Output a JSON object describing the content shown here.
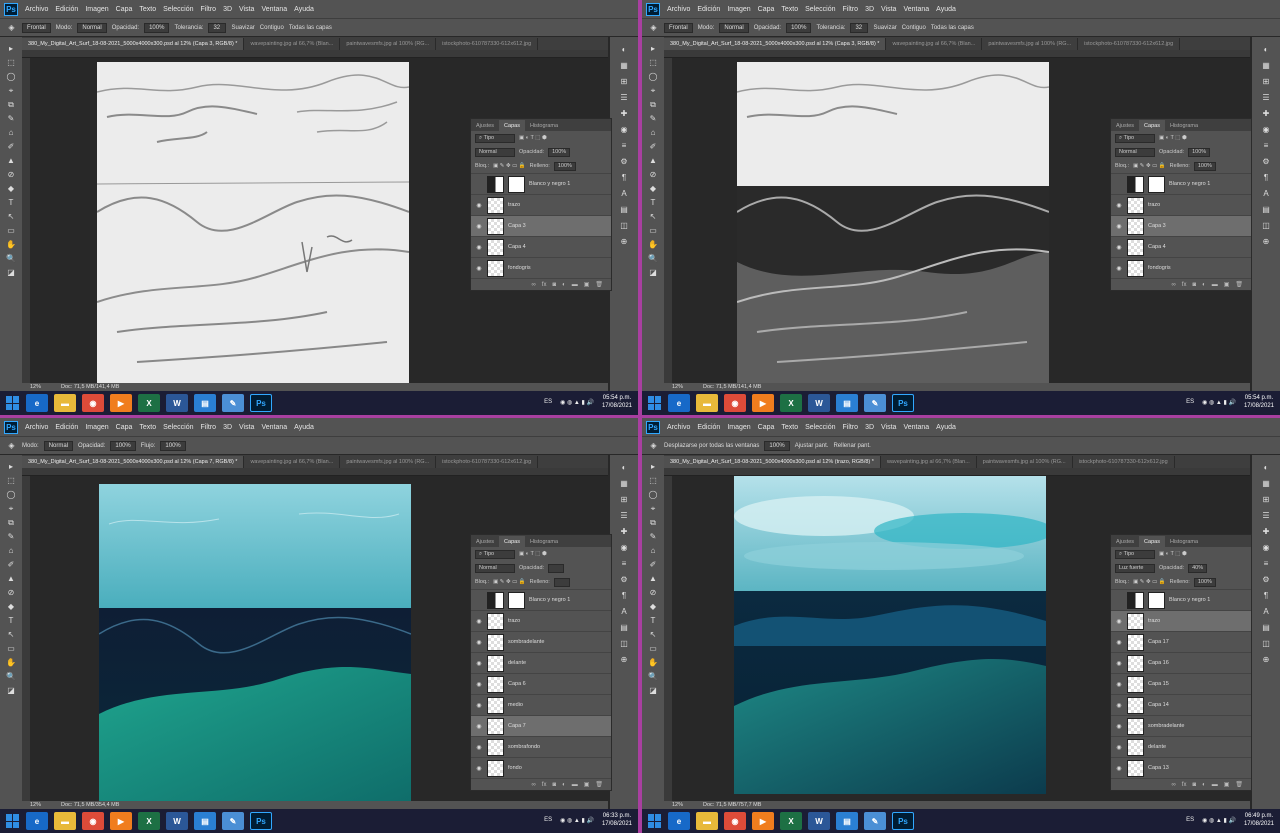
{
  "menu": [
    "Archivo",
    "Edición",
    "Imagen",
    "Capa",
    "Texto",
    "Selección",
    "Filtro",
    "3D",
    "Vista",
    "Ventana",
    "Ayuda"
  ],
  "app_logo": "Ps",
  "quadrants": [
    {
      "id": "tl",
      "options": [
        "Frontal",
        "Modo:",
        "Normal",
        "Opacidad:",
        "100%",
        "Tolerancia:",
        "32",
        "Suavizar",
        "Contiguo",
        "Todas las capas"
      ],
      "tabs": [
        "380_My_Digital_Art_Surf_18-08-2021_5000x4000x300.psd al 12% (Capa 3, RGB/8) *",
        "wavepainting.jpg al 66,7% (Blan...",
        "paintwavesmfs.jpg al 100% (RG...",
        "istockphoto-610787330-612x612.jpg"
      ],
      "zoom": "12%",
      "doc": "Doc: 71,5 MB/141,4 MB",
      "panel_tabs": [
        "Ajustes",
        "Capas",
        "Histograma"
      ],
      "filter": "Tipo",
      "blend": "Normal",
      "opacity_label": "Opacidad:",
      "opacity": "100%",
      "fill_label": "Relleno:",
      "fill": "100%",
      "lock": "Bloq.:",
      "layers": [
        "Blanco y negro 1",
        "trazo",
        "Capa 3",
        "Capa 4",
        "fondogris"
      ],
      "selected": 2,
      "time": "05:54 p.m.",
      "date": "17/08/2021"
    },
    {
      "id": "tr",
      "options": [
        "Frontal",
        "Modo:",
        "Normal",
        "Opacidad:",
        "100%",
        "Tolerancia:",
        "32",
        "Suavizar",
        "Contiguo",
        "Todas las capas"
      ],
      "tabs": [
        "380_My_Digital_Art_Surf_18-08-2021_5000x4000x300.psd al 12% (Capa 3, RGB/8) *",
        "wavepainting.jpg al 66,7% (Blan...",
        "paintwavesmfs.jpg al 100% (RG...",
        "istockphoto-610787330-612x612.jpg"
      ],
      "zoom": "12%",
      "doc": "Doc: 71,5 MB/141,4 MB",
      "panel_tabs": [
        "Ajustes",
        "Capas",
        "Histograma"
      ],
      "filter": "Tipo",
      "blend": "Normal",
      "opacity_label": "Opacidad:",
      "opacity": "100%",
      "fill_label": "Relleno:",
      "fill": "100%",
      "lock": "Bloq.:",
      "layers": [
        "Blanco y negro 1",
        "trazo",
        "Capa 3",
        "Capa 4",
        "fondogris"
      ],
      "selected": 2,
      "time": "05:54 p.m.",
      "date": "17/08/2021"
    },
    {
      "id": "bl",
      "options": [
        "Modo:",
        "Normal",
        "Opacidad:",
        "100%",
        "Flujo:",
        "100%"
      ],
      "tabs": [
        "380_My_Digital_Art_Surf_18-08-2021_5000x4000x300.psd al 12% (Capa 7, RGB/8) *",
        "wavepainting.jpg al 66,7% (Blan...",
        "paintwavesmfs.jpg al 100% (RG...",
        "istockphoto-610787330-612x612.jpg"
      ],
      "zoom": "12%",
      "doc": "Doc: 71,5 MB/354,4 MB",
      "panel_tabs": [
        "Ajustes",
        "Capas",
        "Histograma"
      ],
      "filter": "Tipo",
      "blend": "Normal",
      "opacity_label": "Opacidad:",
      "opacity": "",
      "fill_label": "Relleno:",
      "fill": "",
      "lock": "Bloq.:",
      "layers": [
        "Blanco y negro 1",
        "trazo",
        "sombradelante",
        "delante",
        "Capa 6",
        "medio",
        "Capa 7",
        "sombrafondo",
        "fondo"
      ],
      "selected": 6,
      "time": "06:33 p.m.",
      "date": "17/08/2021"
    },
    {
      "id": "br",
      "options": [
        "Desplazarse por todas las ventanas",
        "100%",
        "Ajustar pant.",
        "Rellenar pant."
      ],
      "tabs": [
        "380_My_Digital_Art_Surf_18-08-2021_5000x4000x300.psd al 12% (trazo, RGB/8) *",
        "wavepainting.jpg al 66,7% (Blan...",
        "paintwavesmfs.jpg al 100% (RG...",
        "istockphoto-610787330-612x612.jpg"
      ],
      "zoom": "12%",
      "doc": "Doc: 71,5 MB/757,7 MB",
      "panel_tabs": [
        "Ajustes",
        "Capas",
        "Histograma"
      ],
      "filter": "Tipo",
      "blend": "Luz fuerte",
      "opacity_label": "Opacidad:",
      "opacity": "40%",
      "fill_label": "Relleno:",
      "fill": "100%",
      "lock": "Bloq.:",
      "layers": [
        "Blanco y negro 1",
        "trazo",
        "Capa 17",
        "Capa 16",
        "Capa 15",
        "Capa 14",
        "sombradelante",
        "delante",
        "Capa 13"
      ],
      "selected": 1,
      "time": "06:49 p.m.",
      "date": "17/08/2021"
    }
  ],
  "taskbar_lang": "ES",
  "taskbar_apps": [
    "ie",
    "folder",
    "chrome",
    "media",
    "excel",
    "word",
    "file",
    "notes",
    "photoshop"
  ]
}
